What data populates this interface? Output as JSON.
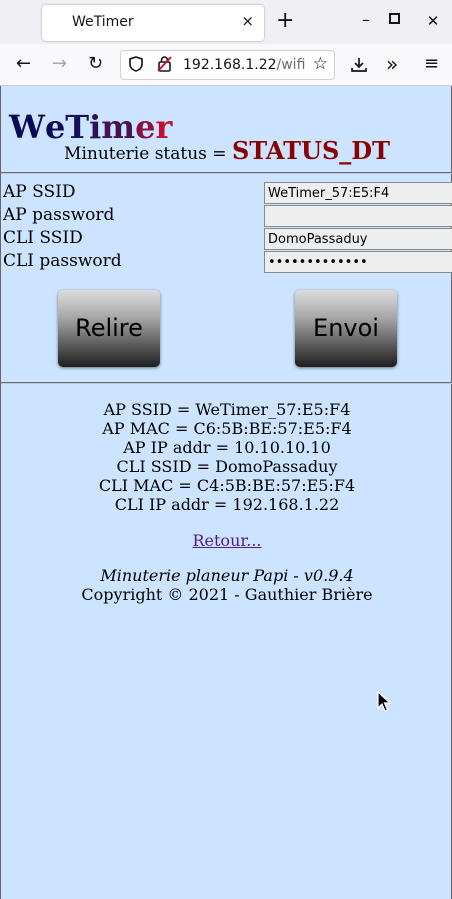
{
  "browser": {
    "tab_title": "WeTimer",
    "tab_close": "×",
    "new_tab": "+",
    "url_host": "192.168.1.22",
    "url_path": "/wifi"
  },
  "page": {
    "logo_letters": [
      {
        "ch": "W",
        "color": "#0a0a55"
      },
      {
        "ch": "e",
        "color": "#0a0a55"
      },
      {
        "ch": "T",
        "color": "#15105a"
      },
      {
        "ch": "i",
        "color": "#2a1258"
      },
      {
        "ch": "m",
        "color": "#451353"
      },
      {
        "ch": "e",
        "color": "#8a1040"
      },
      {
        "ch": "r",
        "color": "#c4102e"
      }
    ],
    "status_label": "Minuterie status = ",
    "status_value": "STATUS_DT",
    "form": {
      "ap_ssid_label": "AP SSID",
      "ap_ssid_value": "WeTimer_57:E5:F4",
      "ap_password_label": "AP password",
      "ap_password_value": "",
      "cli_ssid_label": "CLI SSID",
      "cli_ssid_value": "DomoPassaduy",
      "cli_password_label": "CLI password",
      "cli_password_value": "•••••••••••••"
    },
    "buttons": {
      "relire": "Relire",
      "envoi": "Envoi"
    },
    "info_lines": [
      "AP SSID = WeTimer_57:E5:F4",
      "AP MAC = C6:5B:BE:57:E5:F4",
      "AP IP addr = 10.10.10.10",
      "CLI SSID = DomoPassaduy",
      "CLI MAC = C4:5B:BE:57:E5:F4",
      "CLI IP addr = 192.168.1.22"
    ],
    "retour_link": "Retour...",
    "footer_version": "Minuterie planeur Papi - v0.9.4",
    "footer_copyright": "Copyright © 2021 - Gauthier Brière"
  },
  "colors": {
    "page_bg": "#cce4ff",
    "status_value": "#8b0000",
    "link": "#551a8b"
  }
}
